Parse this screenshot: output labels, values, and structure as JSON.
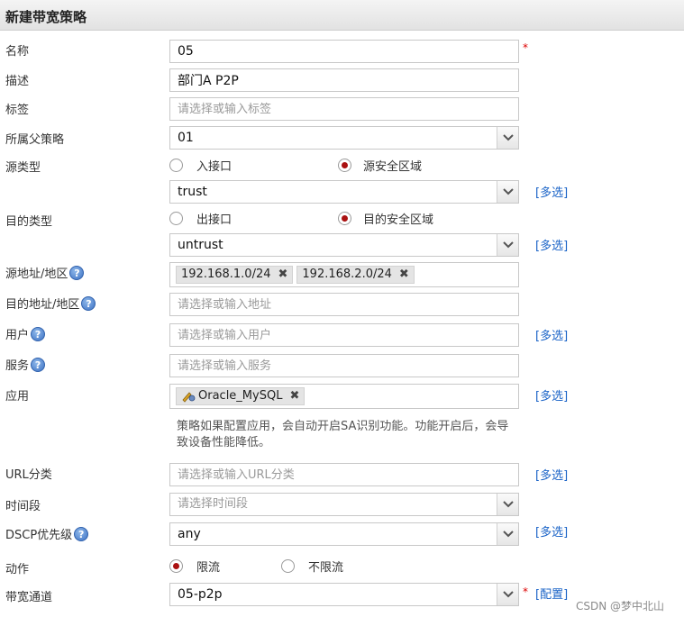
{
  "title": "新建带宽策略",
  "fields": {
    "name": {
      "label": "名称",
      "value": "05"
    },
    "desc": {
      "label": "描述",
      "value": "部门A P2P"
    },
    "tag": {
      "label": "标签",
      "placeholder": "请选择或输入标签"
    },
    "parent": {
      "label": "所属父策略",
      "value": "01"
    },
    "src_type": {
      "label": "源类型",
      "opt1": "入接口",
      "opt2": "源安全区域",
      "selected": "源安全区域"
    },
    "src_zone": {
      "value": "trust",
      "multi": "[多选]"
    },
    "dst_type": {
      "label": "目的类型",
      "opt1": "出接口",
      "opt2": "目的安全区域",
      "selected": "目的安全区域"
    },
    "dst_zone": {
      "value": "untrust",
      "multi": "[多选]"
    },
    "src_addr": {
      "label": "源地址/地区",
      "tags": [
        "192.168.1.0/24",
        "192.168.2.0/24"
      ]
    },
    "dst_addr": {
      "label": "目的地址/地区",
      "placeholder": "请选择或输入地址"
    },
    "user": {
      "label": "用户",
      "placeholder": "请选择或输入用户",
      "multi": "[多选]"
    },
    "service": {
      "label": "服务",
      "placeholder": "请选择或输入服务"
    },
    "app": {
      "label": "应用",
      "tag": "Oracle_MySQL",
      "multi": "[多选]"
    },
    "app_note": "策略如果配置应用，会自动开启SA识别功能。功能开启后，会导致设备性能降低。",
    "url": {
      "label": "URL分类",
      "placeholder": "请选择或输入URL分类",
      "multi": "[多选]"
    },
    "time": {
      "label": "时间段",
      "placeholder": "请选择时间段"
    },
    "dscp": {
      "label": "DSCP优先级",
      "value": "any",
      "multi": "[多选]"
    },
    "action": {
      "label": "动作",
      "opt1": "限流",
      "opt2": "不限流",
      "selected": "限流"
    },
    "channel": {
      "label": "带宽通道",
      "value": "05-p2p",
      "config": "[配置]"
    }
  },
  "required_mark": "*",
  "help_glyph": "?",
  "remove_glyph": "✖",
  "watermark": "CSDN @梦中北山",
  "colors": {
    "link": "#1a63c7",
    "radio_on": "#aa1111",
    "required": "#dd0000"
  }
}
